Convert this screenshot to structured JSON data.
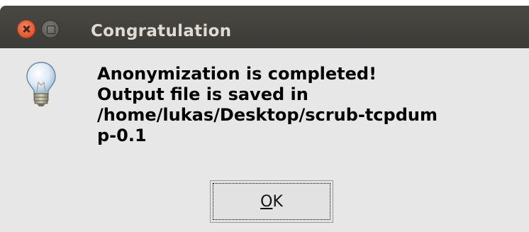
{
  "window": {
    "title": "Congratulation"
  },
  "titlebar_buttons": {
    "close_icon": "close-icon",
    "minimize_icon": "window-minimize-icon"
  },
  "dialog": {
    "icon": "lightbulb-icon",
    "message_lines": [
      "Anonymization is completed!",
      "Output file is saved in",
      "/home/lukas/Desktop/scrub-tcpdum",
      "p-0.1"
    ],
    "ok_button": {
      "mnemonic": "O",
      "rest": "K"
    }
  },
  "colors": {
    "titlebar": "#3c3b37",
    "title_text": "#dfdbd2",
    "close_button": "#e2572c",
    "dialog_bg": "#e7e7e7"
  }
}
